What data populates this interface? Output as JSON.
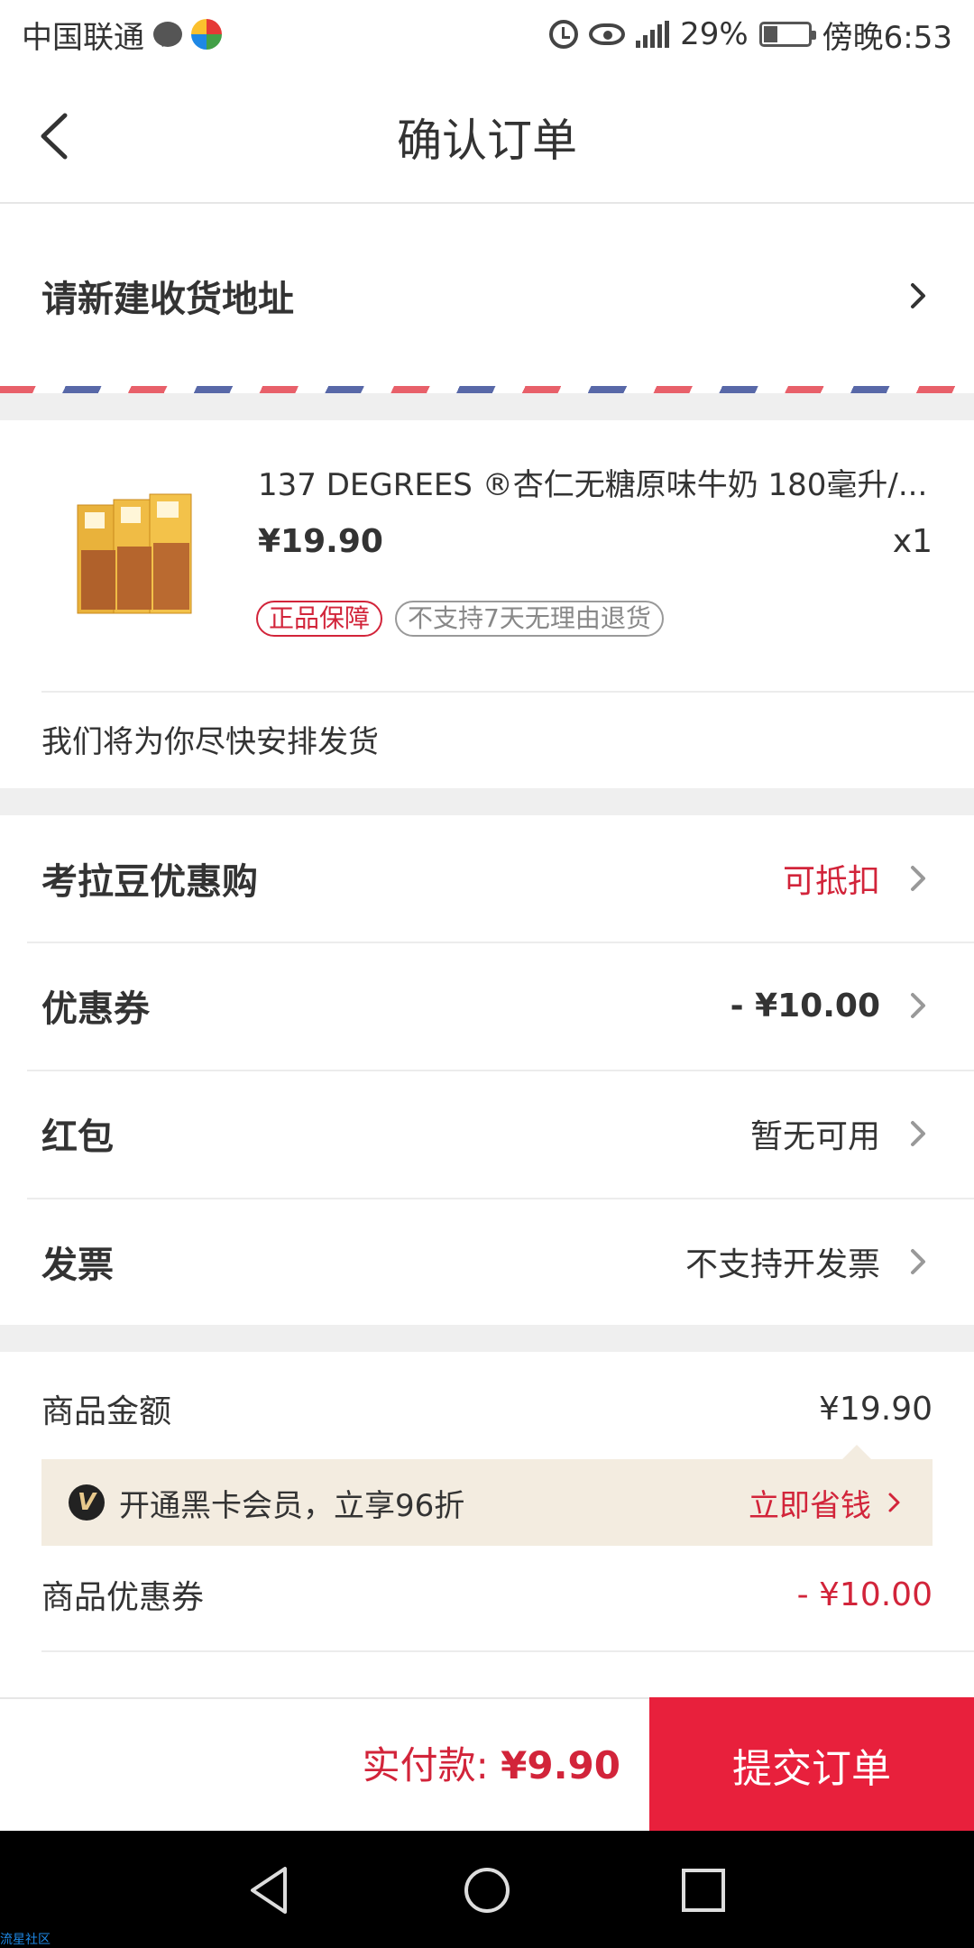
{
  "status_bar": {
    "carrier": "中国联通",
    "battery": "29%",
    "time": "傍晚6:53",
    "icons": [
      "chat-bubble-icon",
      "app-dots-icon",
      "alarm-icon",
      "eye-icon",
      "signal-icon",
      "battery-icon"
    ]
  },
  "header": {
    "title": "确认订单"
  },
  "address": {
    "prompt": "请新建收货地址"
  },
  "product": {
    "title": "137 DEGREES ®杏仁无糖原味牛奶 180毫升/...",
    "price": "¥19.90",
    "quantity": "x1",
    "tag_guarantee": "正品保障",
    "tag_no_return": "不支持7天无理由退货",
    "shipping_note": "我们将为你尽快安排发货"
  },
  "options": [
    {
      "label": "考拉豆优惠购",
      "value": "可抵扣",
      "style": "red"
    },
    {
      "label": "优惠券",
      "value": "- ¥10.00",
      "style": "bold"
    },
    {
      "label": "红包",
      "value": "暂无可用",
      "style": "normal"
    },
    {
      "label": "发票",
      "value": "不支持开发票",
      "style": "normal"
    }
  ],
  "summary": {
    "goods_amount_label": "商品金额",
    "goods_amount_value": "¥19.90",
    "vip_icon_text": "V",
    "vip_text": "开通黑卡会员，立享96折",
    "vip_link": "立即省钱",
    "coupon_label": "商品优惠券",
    "coupon_value": "- ¥10.00"
  },
  "bottom_bar": {
    "pay_label": "实付款: ",
    "pay_amount": "¥9.90",
    "submit_label": "提交订单"
  },
  "watermark": "流星社区",
  "colors": {
    "accent_red": "#d2243a",
    "submit_red": "#e8203c",
    "vip_bg": "#f3ece0"
  }
}
